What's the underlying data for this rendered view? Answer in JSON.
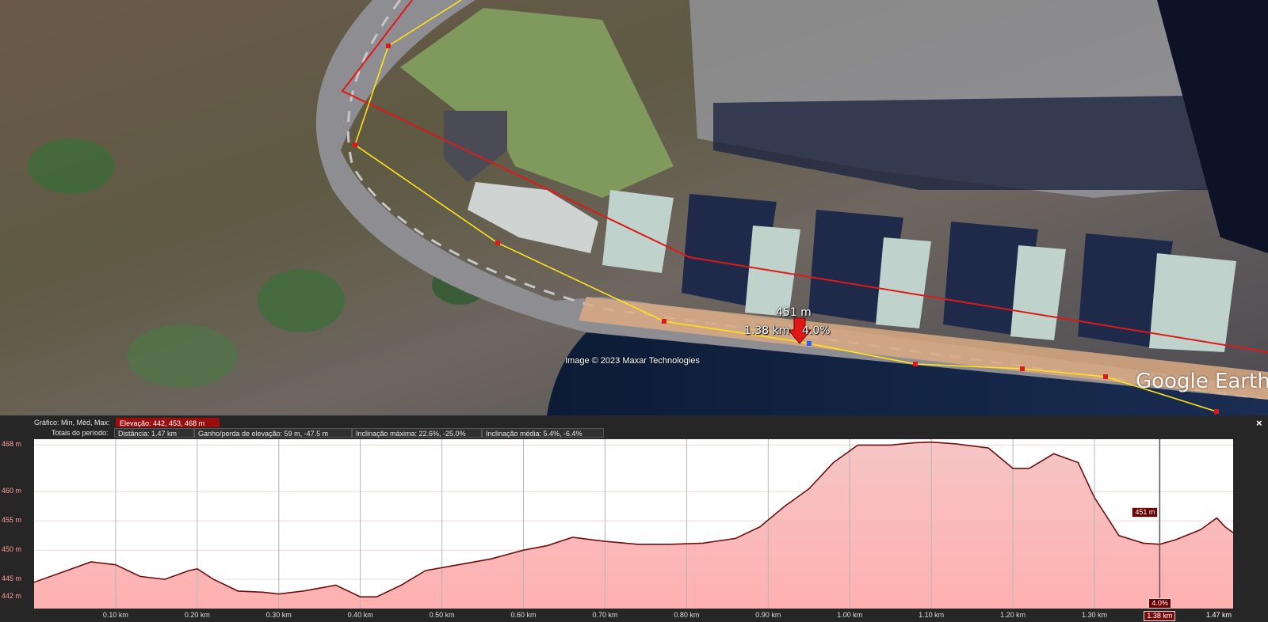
{
  "map": {
    "point_label_elev": "451 m",
    "point_label_dist": "1.38 km",
    "point_label_grade": "4.0%",
    "copyright": "Image © 2023 Maxar Technologies",
    "logo": "Google Earth",
    "colors": {
      "path": "#ffe21a",
      "track": "#e01818",
      "marker": "#e01818"
    }
  },
  "panel": {
    "graph_label": "Gráfico: Min, Méd, Max:",
    "elevation_stat": "Elevação: 442, 453, 468 m",
    "totals_label": "Totais do período:",
    "distance": "Distância: 1.47 km",
    "gain_loss": "Ganho/perda de elevação: 59 m, -47.5 m",
    "max_slope": "Inclinação máxima: 22.6%, -25.0%",
    "avg_slope": "Inclinação média: 5.4%, -6.4%",
    "close_icon": "×",
    "cursor_elev": "451 m",
    "cursor_grade": "4.0%",
    "cursor_dist": "1.38 km",
    "x_end_label": "1.47 km"
  },
  "chart_data": {
    "type": "area",
    "ylim": [
      440,
      469
    ],
    "xlim": [
      0,
      1.47
    ],
    "y_ticks": [
      {
        "value": 468,
        "label": "468 m"
      },
      {
        "value": 460,
        "label": "460 m"
      },
      {
        "value": 455,
        "label": "455 m"
      },
      {
        "value": 450,
        "label": "450 m"
      },
      {
        "value": 445,
        "label": "445 m"
      },
      {
        "value": 442,
        "label": "442 m"
      }
    ],
    "x_ticks": [
      {
        "value": 0.1,
        "label": "0.10 km"
      },
      {
        "value": 0.2,
        "label": "0.20 km"
      },
      {
        "value": 0.3,
        "label": "0.30 km"
      },
      {
        "value": 0.4,
        "label": "0.40 km"
      },
      {
        "value": 0.5,
        "label": "0.50 km"
      },
      {
        "value": 0.6,
        "label": "0.60 km"
      },
      {
        "value": 0.7,
        "label": "0.70 km"
      },
      {
        "value": 0.8,
        "label": "0.80 km"
      },
      {
        "value": 0.9,
        "label": "0.90 km"
      },
      {
        "value": 1.0,
        "label": "1.00 km"
      },
      {
        "value": 1.1,
        "label": "1.10 km"
      },
      {
        "value": 1.2,
        "label": "1.20 km"
      },
      {
        "value": 1.3,
        "label": "1.30 km"
      }
    ],
    "cursor_x": 1.38,
    "x": [
      0.0,
      0.03,
      0.07,
      0.1,
      0.13,
      0.16,
      0.19,
      0.2,
      0.22,
      0.25,
      0.28,
      0.3,
      0.33,
      0.35,
      0.37,
      0.4,
      0.42,
      0.45,
      0.48,
      0.52,
      0.56,
      0.6,
      0.63,
      0.66,
      0.7,
      0.74,
      0.78,
      0.82,
      0.86,
      0.89,
      0.92,
      0.95,
      0.98,
      1.01,
      1.03,
      1.05,
      1.08,
      1.1,
      1.13,
      1.17,
      1.2,
      1.22,
      1.25,
      1.28,
      1.3,
      1.33,
      1.36,
      1.38,
      1.4,
      1.43,
      1.45,
      1.46,
      1.47
    ],
    "y": [
      444.5,
      446.0,
      448.0,
      447.5,
      445.5,
      445.0,
      446.5,
      446.8,
      445.0,
      443.0,
      442.8,
      442.5,
      443.0,
      443.5,
      444.0,
      442.0,
      442.0,
      444.0,
      446.5,
      447.5,
      448.5,
      450.0,
      450.8,
      452.2,
      451.5,
      451.0,
      451.0,
      451.2,
      452.0,
      454.0,
      457.5,
      460.5,
      465.0,
      468.0,
      468.0,
      468.0,
      468.4,
      468.5,
      468.2,
      467.5,
      464.0,
      464.0,
      466.5,
      465.0,
      459.0,
      452.5,
      451.2,
      451.0,
      451.8,
      453.5,
      455.5,
      454.0,
      453.0
    ]
  }
}
